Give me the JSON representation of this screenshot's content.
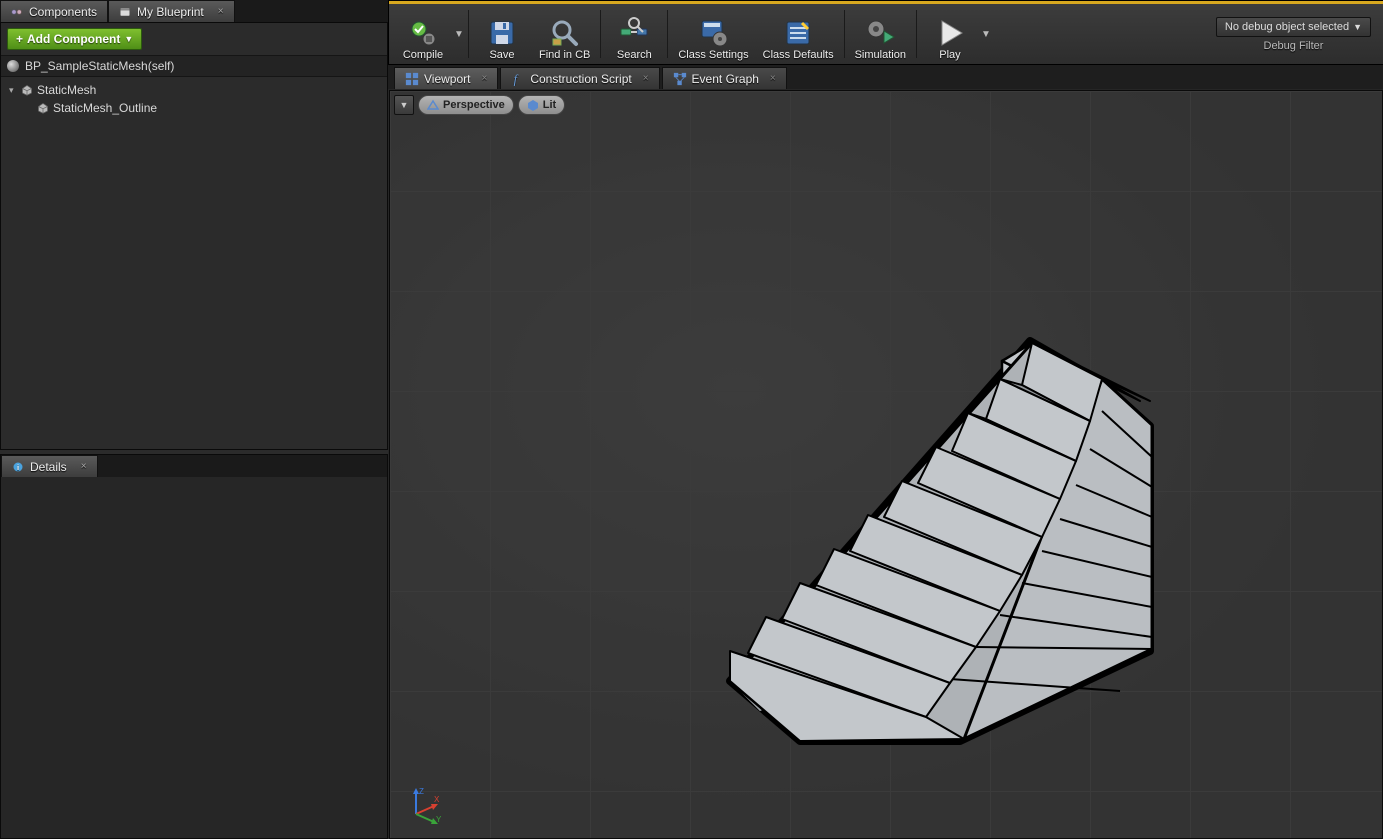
{
  "tabs": {
    "components": "Components",
    "my_blueprint": "My Blueprint",
    "details": "Details"
  },
  "components_panel": {
    "add_button": "Add Component",
    "self_row": "BP_SampleStaticMesh(self)",
    "tree": {
      "item0": "StaticMesh",
      "item1": "StaticMesh_Outline"
    }
  },
  "toolbar": {
    "compile": "Compile",
    "save": "Save",
    "find_in_cb": "Find in CB",
    "search": "Search",
    "class_settings": "Class Settings",
    "class_defaults": "Class Defaults",
    "simulation": "Simulation",
    "play": "Play",
    "debug_placeholder": "No debug object selected",
    "debug_filter": "Debug Filter"
  },
  "main_tabs": {
    "viewport": "Viewport",
    "construction_script": "Construction Script",
    "event_graph": "Event Graph"
  },
  "viewport_controls": {
    "perspective": "Perspective",
    "lit": "Lit"
  },
  "axis": {
    "x": "X",
    "y": "Y",
    "z": "Z"
  }
}
